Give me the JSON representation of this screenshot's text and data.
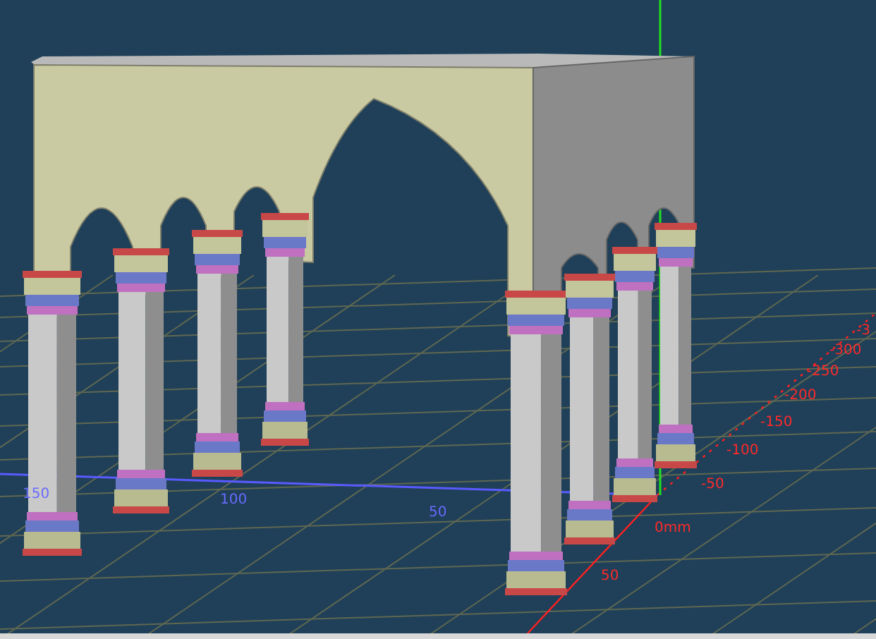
{
  "viewport": {
    "blue_axis_labels": [
      "150",
      "100",
      "50"
    ],
    "red_axis_labels": [
      "0mm",
      "50",
      "-50",
      "-100",
      "-150",
      "-200",
      "-250",
      "-300",
      "-3"
    ]
  }
}
